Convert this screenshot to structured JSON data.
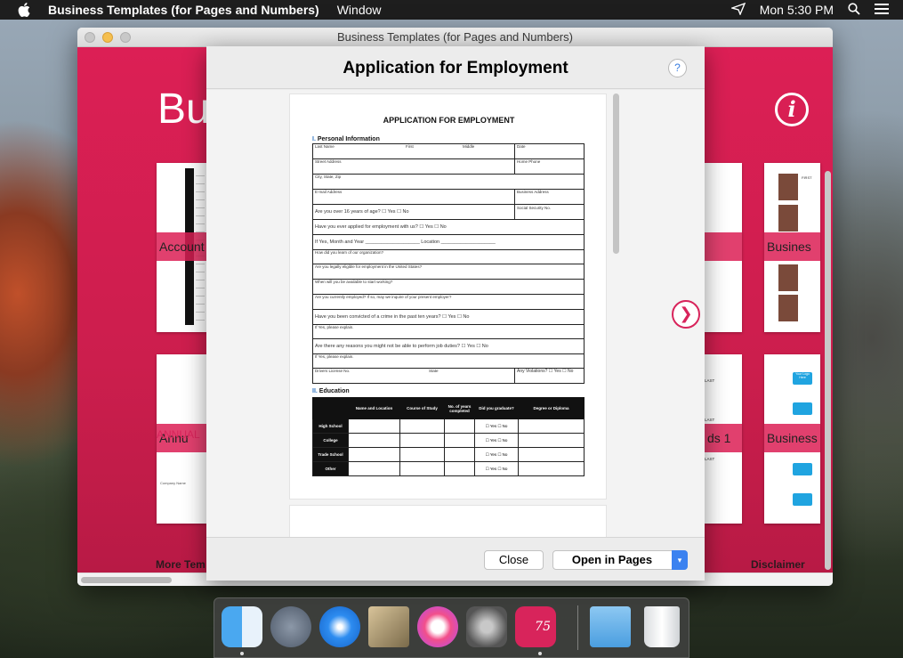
{
  "menubar": {
    "app_name": "Business Templates (for Pages and Numbers)",
    "menu_window": "Window",
    "clock": "Mon 5:30 PM"
  },
  "window": {
    "title": "Business Templates (for Pages and Numbers)",
    "big_title": "Bu",
    "thumb_labels": {
      "accounting": "Account",
      "annual": "Annu",
      "business_top": "Busines",
      "cards": "ds 1",
      "business_bottom": "Business"
    },
    "footer_left": "More Tem",
    "footer_right": "Disclaimer",
    "annual_text": "ANNUAL",
    "company_name": "Company Name",
    "last_label": "LAST",
    "first_label": "FIRST",
    "logo_label": "Your Logo Here"
  },
  "modal": {
    "title": "Application for Employment",
    "help": "?",
    "prev": "❮",
    "next": "❯",
    "close_label": "Close",
    "open_label": "Open in Pages",
    "dropdown": "▾"
  },
  "form": {
    "title": "APPLICATION FOR EMPLOYMENT",
    "sec1_num": "I.",
    "sec1": "Personal Information",
    "last_name": "Last Name",
    "first": "First",
    "middle": "Middle",
    "date": "Date",
    "street": "Street Address",
    "home_phone": "Home Phone",
    "city": "City, State, Zip",
    "email": "E-mail Address",
    "business_address": "Business Address",
    "over16": "Are you over 16 years of age?    ☐ Yes    ☐ No",
    "ssn": "Social Security No.",
    "applied": "Have you ever applied for employment with us?    ☐ Yes    ☐ No",
    "month_year": "If Yes, Month and Year ____________________   Location ____________________",
    "learn": "How did you learn of our organization?",
    "eligible": "Are you legally eligible for employment in the United States?",
    "available": "When will you be available to start working?",
    "employed": "Are you currently employed?  If so, may we inquire of your present employer?",
    "convicted": "Have you been convicted of a crime in the past ten years?    ☐ Yes    ☐ No",
    "explain": "If Yes, please explain.",
    "duties": "Are there any reasons you might not be able to perform job duties?    ☐ Yes    ☐ No",
    "license": "Drivers License No.",
    "state": "State",
    "violations": "Any Violations?  ☐ Yes  ☐ No",
    "sec2_num": "II.",
    "sec2": "Education",
    "edu_headers": [
      "",
      "Name and Location",
      "Course of Study",
      "No. of years completed",
      "Did you graduate?",
      "Degree or Diploma"
    ],
    "edu_rows": [
      "High School",
      "College",
      "Trade School",
      "Other"
    ],
    "yes_no": "☐ Yes   ☐ No"
  },
  "dock": {
    "badge": "75"
  }
}
